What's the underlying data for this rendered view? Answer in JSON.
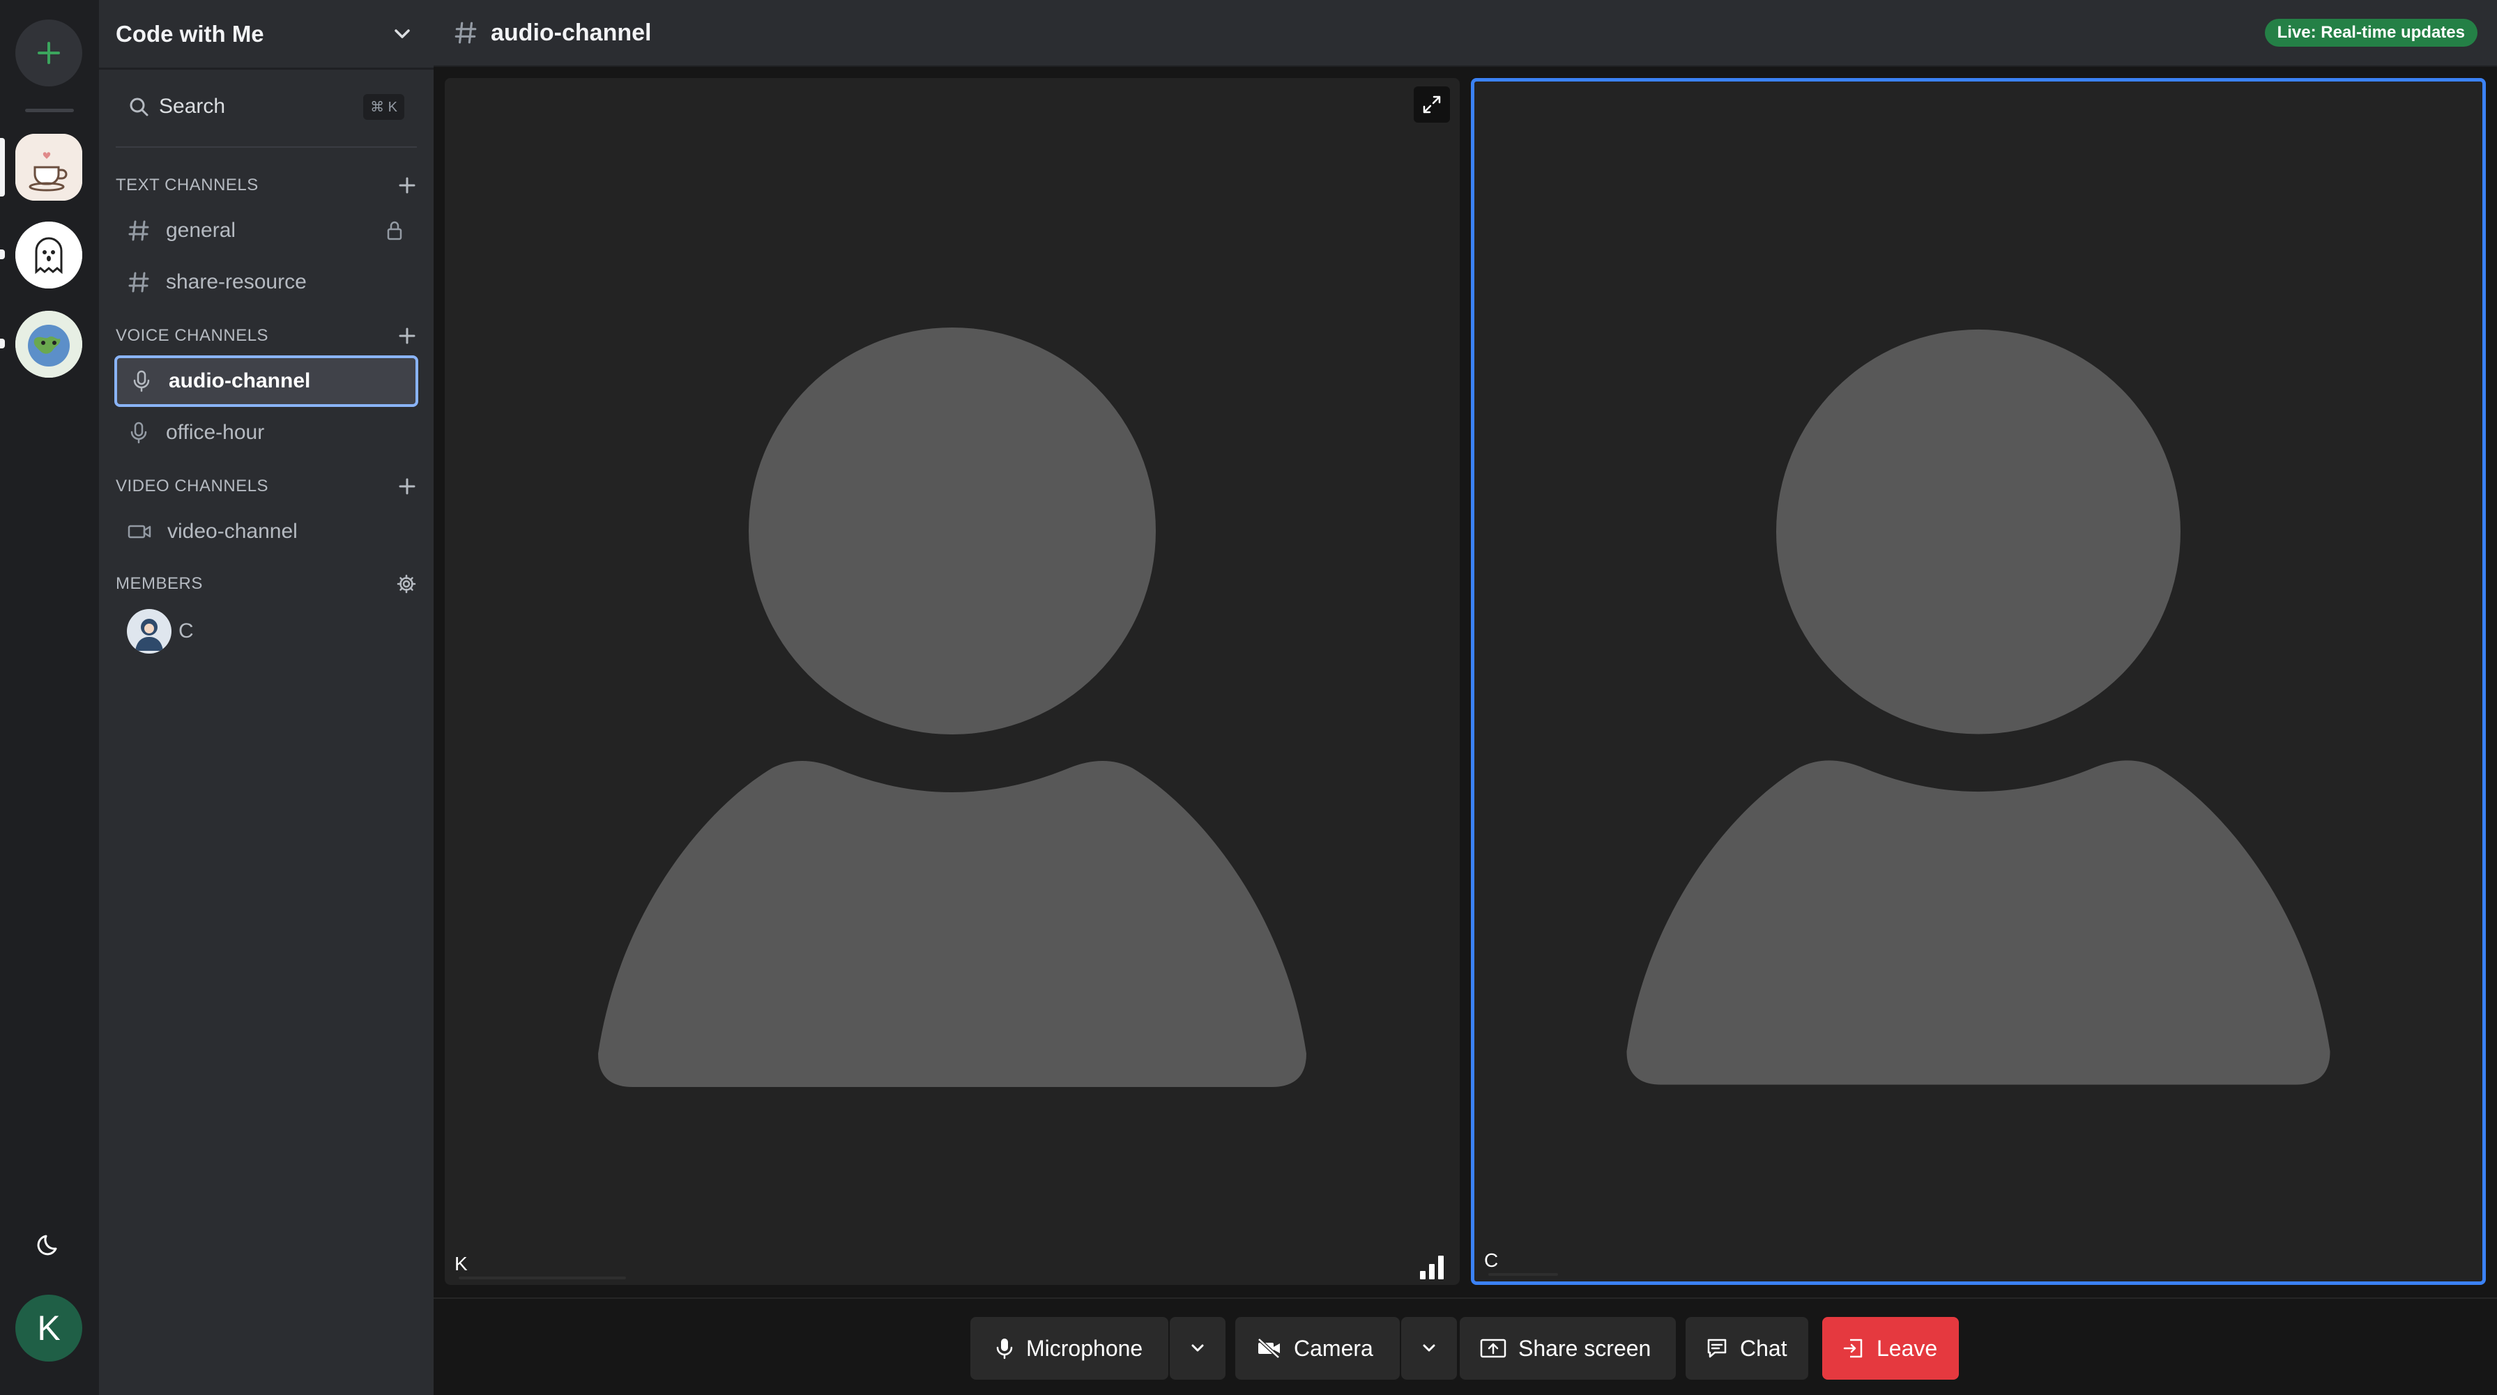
{
  "server": {
    "name": "Code with Me"
  },
  "search": {
    "label": "Search",
    "shortcut": "⌘ K"
  },
  "sections": {
    "text": {
      "title": "TEXT CHANNELS",
      "channels": [
        "general",
        "share-resource"
      ]
    },
    "voice": {
      "title": "VOICE CHANNELS",
      "channels": [
        "audio-channel",
        "office-hour"
      ]
    },
    "video": {
      "title": "VIDEO CHANNELS",
      "channels": [
        "video-channel"
      ]
    },
    "members": {
      "title": "MEMBERS",
      "list": [
        "C"
      ]
    }
  },
  "topbar": {
    "channel": "audio-channel",
    "badge": "Live: Real-time updates"
  },
  "tiles": [
    {
      "participant": "K",
      "speaking": false
    },
    {
      "participant": "C",
      "speaking": true
    }
  ],
  "controls": {
    "microphone": "Microphone",
    "camera": "Camera",
    "share_screen": "Share screen",
    "chat": "Chat",
    "leave": "Leave"
  },
  "user": {
    "initial": "K"
  },
  "colors": {
    "accent": "#3b82f6",
    "live": "#248046",
    "leave": "#e5393f",
    "add": "#3ba55d"
  },
  "icons": [
    "plus-icon",
    "moon-icon",
    "chevron-down-icon",
    "search-icon",
    "hash-icon",
    "lock-icon",
    "mic-icon",
    "video-icon",
    "gear-icon",
    "expand-icon",
    "signal-icon",
    "camera-off-icon",
    "share-screen-icon",
    "chat-icon",
    "leave-icon"
  ]
}
